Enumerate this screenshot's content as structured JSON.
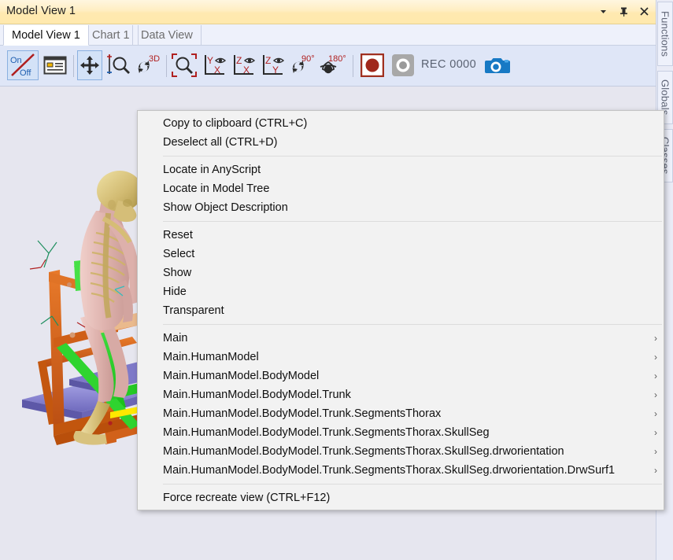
{
  "window": {
    "title": "Model View 1",
    "buttons": [
      {
        "name": "window-menu-button",
        "icon": "chevron-down-icon",
        "glyph": "▼"
      },
      {
        "name": "pin-window-button",
        "icon": "pin-icon",
        "glyph": "✕"
      },
      {
        "name": "close-window-button",
        "icon": "close-icon",
        "glyph": "✕"
      }
    ]
  },
  "tabs": [
    {
      "label": "Model View 1",
      "active": true
    },
    {
      "label": "Chart 1",
      "active": false
    },
    {
      "label": "Data View",
      "active": false
    }
  ],
  "toolbar": {
    "rec_label": "REC  0000",
    "buttons": [
      {
        "name": "toggle-on-off-button",
        "icon": "on-off-icon",
        "tooltip": "On/Off",
        "top_text": "On",
        "bottom_text": "Off",
        "pressed": true
      },
      {
        "name": "legend-panel-button",
        "icon": "legend-icon",
        "tooltip": "Show legend",
        "pressed": false
      },
      {
        "name": "pan-tool-button",
        "icon": "move-arrows-icon",
        "tooltip": "Pan",
        "pressed": true
      },
      {
        "name": "zoom-in-out-button",
        "icon": "zoom-plus-minus-icon",
        "tooltip": "Zoom in/out",
        "pressed": false
      },
      {
        "name": "rotate-3d-button",
        "icon": "rotate-3d-icon",
        "tooltip": "3D rotate",
        "label": "3D",
        "pressed": false
      },
      {
        "name": "zoom-window-button",
        "icon": "zoom-region-icon",
        "tooltip": "Zoom to region",
        "pressed": false
      },
      {
        "name": "view-yx-button",
        "icon": "axis-yx-eye-icon",
        "tooltip": "View Y-X",
        "axis_v": "Y",
        "axis_h": "X",
        "pressed": false
      },
      {
        "name": "view-zx-button",
        "icon": "axis-zx-eye-icon",
        "tooltip": "View Z-X",
        "axis_v": "Z",
        "axis_h": "X",
        "pressed": false
      },
      {
        "name": "view-zy-button",
        "icon": "axis-zy-eye-icon",
        "tooltip": "View Z-Y",
        "axis_v": "Z",
        "axis_h": "Y",
        "pressed": false
      },
      {
        "name": "rotate-90-button",
        "icon": "rotate-90-icon",
        "tooltip": "Rotate 90 degrees",
        "label": "90°",
        "pressed": false
      },
      {
        "name": "rotate-180-button",
        "icon": "rotate-180-icon",
        "tooltip": "Rotate 180 degrees",
        "label": "180°",
        "pressed": false
      },
      {
        "name": "record-button",
        "icon": "record-circle-icon",
        "tooltip": "Record",
        "pressed": true
      },
      {
        "name": "stop-record-button",
        "icon": "stop-record-icon",
        "tooltip": "Stop recording",
        "pressed": false
      },
      {
        "name": "camera-snapshot-button",
        "icon": "camera-icon",
        "tooltip": "Take snapshot",
        "pressed": false
      }
    ]
  },
  "side_rail": {
    "tabs": [
      {
        "label": "Functions"
      },
      {
        "label": "Globals"
      },
      {
        "label": "Classes"
      }
    ]
  },
  "context_menu": {
    "groups": [
      {
        "items": [
          {
            "label": "Copy to clipboard (CTRL+C)",
            "submenu": false
          },
          {
            "label": "Deselect all (CTRL+D)",
            "submenu": false
          }
        ]
      },
      {
        "items": [
          {
            "label": "Locate in AnyScript",
            "submenu": false
          },
          {
            "label": "Locate in Model Tree",
            "submenu": false
          },
          {
            "label": "Show Object Description",
            "submenu": false
          }
        ]
      },
      {
        "items": [
          {
            "label": "Reset",
            "submenu": false
          },
          {
            "label": "Select",
            "submenu": false
          },
          {
            "label": "Show",
            "submenu": false
          },
          {
            "label": "Hide",
            "submenu": false
          },
          {
            "label": "Transparent",
            "submenu": false
          }
        ]
      },
      {
        "items": [
          {
            "label": "Main",
            "submenu": true
          },
          {
            "label": "Main.HumanModel",
            "submenu": true
          },
          {
            "label": "Main.HumanModel.BodyModel",
            "submenu": true
          },
          {
            "label": "Main.HumanModel.BodyModel.Trunk",
            "submenu": true
          },
          {
            "label": "Main.HumanModel.BodyModel.Trunk.SegmentsThorax",
            "submenu": true
          },
          {
            "label": "Main.HumanModel.BodyModel.Trunk.SegmentsThorax.SkullSeg",
            "submenu": true
          },
          {
            "label": "Main.HumanModel.BodyModel.Trunk.SegmentsThorax.SkullSeg.drworientation",
            "submenu": true
          },
          {
            "label": "Main.HumanModel.BodyModel.Trunk.SegmentsThorax.SkullSeg.drworientation.DrwSurf1",
            "submenu": true
          }
        ]
      },
      {
        "items": [
          {
            "label": "Force recreate view (CTRL+F12)",
            "submenu": false
          }
        ]
      }
    ],
    "submenu_glyph": "›"
  },
  "viewport": {
    "scene_name": "human-body-model-on-frame",
    "background_color": "#e6e6ef",
    "colors": {
      "skull": "#c9b26a",
      "bone": "#d8c27e",
      "muscle": "#e0b8b4",
      "frame_orange": "#d4621a",
      "frame_green": "#28d828",
      "platform_purple": "#8a86d0",
      "seat_tan": "#e8b88a",
      "highlight_yellow": "#ffe800"
    }
  }
}
